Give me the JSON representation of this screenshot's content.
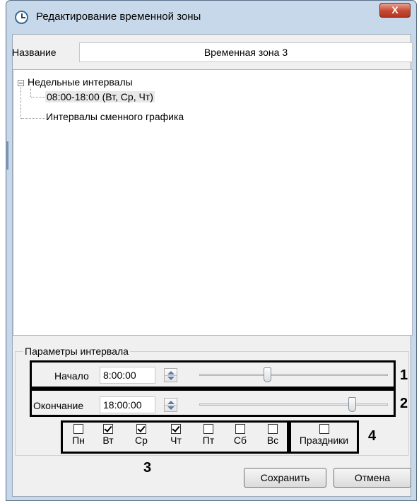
{
  "window": {
    "title": "Редактирование временной зоны",
    "close_glyph": "X"
  },
  "name_field": {
    "label": "Название",
    "value": "Временная зона 3"
  },
  "tree": {
    "root_label": "Недельные интервалы",
    "child_label": "08:00-18:00 (Вт, Ср, Чт)",
    "shift_label": "Интервалы сменного графика"
  },
  "params": {
    "group_title": "Параметры интервала",
    "start_label": "Начало",
    "start_value": "8:00:00",
    "end_label": "Окончание",
    "end_value": "18:00:00"
  },
  "days": [
    {
      "label": "Пн",
      "checked": false
    },
    {
      "label": "Вт",
      "checked": true
    },
    {
      "label": "Ср",
      "checked": true
    },
    {
      "label": "Чт",
      "checked": true
    },
    {
      "label": "Пт",
      "checked": false
    },
    {
      "label": "Сб",
      "checked": false
    },
    {
      "label": "Вс",
      "checked": false
    }
  ],
  "holidays": {
    "label": "Праздники",
    "checked": false
  },
  "callouts": {
    "one": "1",
    "two": "2",
    "three": "3",
    "four": "4"
  },
  "buttons": {
    "save": "Сохранить",
    "cancel": "Отмена"
  }
}
